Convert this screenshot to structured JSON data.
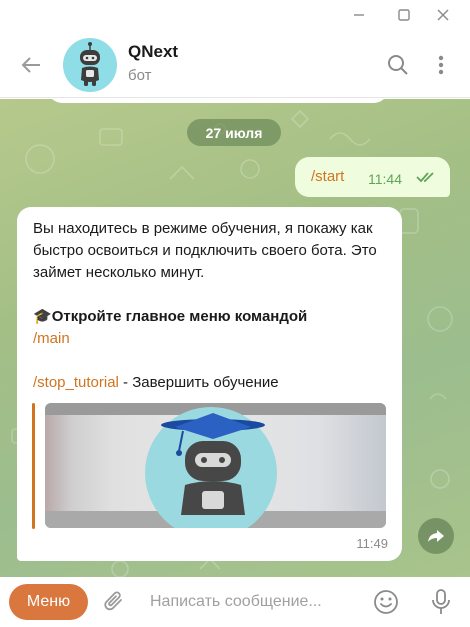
{
  "window": {
    "controls": [
      "minimize-icon",
      "maximize-icon",
      "close-icon"
    ]
  },
  "header": {
    "title": "QNext",
    "subtitle": "бот",
    "icons": [
      "back-arrow-icon",
      "search-icon",
      "more-vertical-icon"
    ]
  },
  "chat": {
    "date_pill": "27 июля",
    "outgoing": {
      "text": "/start",
      "time": "11:44",
      "status_icon": "double-check-icon"
    },
    "incoming": {
      "line_1": "Вы находитесь в режиме обучения, я покажу как быстро освоиться и подключить своего бота. Это займет несколько минут.",
      "emoji": "🎓",
      "bold_text": "Откройте главное меню командой",
      "cmd_main": "/main",
      "cmd_stop": "/stop_tutorial",
      "stop_desc": " - Завершить обучение",
      "time": "11:49"
    },
    "forward_icon": "share-arrow-icon"
  },
  "composer": {
    "menu_label": "Меню",
    "placeholder": "Написать сообщение...",
    "icons": [
      "paperclip-icon",
      "emoji-icon",
      "microphone-icon"
    ]
  },
  "colors": {
    "accent": "#d9773f",
    "link": "#d1741f",
    "outgoing_bubble": "#effdde",
    "read_check": "#5fa55a"
  }
}
